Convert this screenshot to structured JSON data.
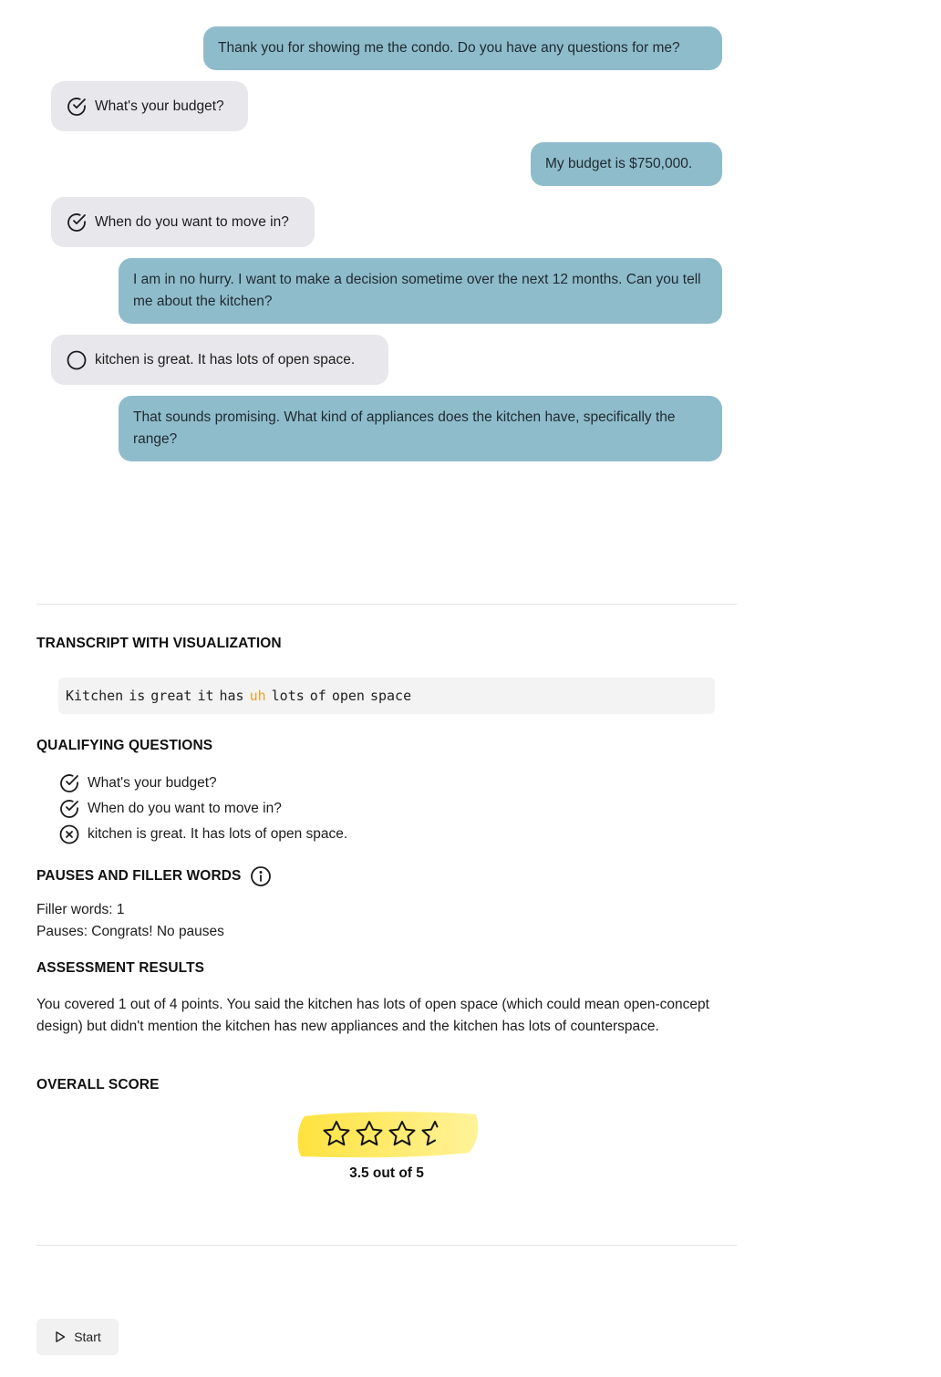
{
  "chat": {
    "messages": [
      {
        "role": "user",
        "text": "Thank you for showing me the condo. Do you have any questions for me?"
      },
      {
        "role": "bot",
        "status": "check",
        "status_icon": "check-circle-icon",
        "text": "What's your budget?"
      },
      {
        "role": "user",
        "text": "My budget is $750,000."
      },
      {
        "role": "bot",
        "status": "check",
        "status_icon": "check-circle-icon",
        "text": "When do you want to move in?"
      },
      {
        "role": "user",
        "text": "I am in no hurry. I want to make a decision sometime over the next 12 months. Can you tell me about the kitchen?"
      },
      {
        "role": "bot",
        "status": "empty",
        "status_icon": "empty-circle-icon",
        "text": "kitchen is great. It has lots of open space."
      },
      {
        "role": "user",
        "text": "That sounds promising. What kind of appliances does the kitchen have, specifically the range?"
      }
    ]
  },
  "transcript": {
    "title": "TRANSCRIPT WITH VISUALIZATION",
    "words": [
      "Kitchen",
      "is",
      "great",
      "it",
      "has",
      "uh",
      "lots",
      "of",
      "open",
      "space"
    ],
    "filler_word": "uh",
    "filler_color": "#f0a323"
  },
  "qualifying": {
    "title": "QUALIFYING QUESTIONS",
    "items": [
      {
        "text": "What's your budget?",
        "status": "check",
        "icon": "check-circle-icon"
      },
      {
        "text": "When do you want to move in?",
        "status": "check",
        "icon": "check-circle-icon"
      },
      {
        "text": "kitchen is great. It has lots of open space.",
        "status": "x",
        "icon": "x-circle-icon"
      }
    ]
  },
  "pauses": {
    "title": "PAUSES AND FILLER WORDS",
    "info_icon": "info-icon",
    "filler_line": "Filler words: 1",
    "pauses_line": "Pauses: Congrats! No pauses"
  },
  "assessment": {
    "title": "ASSESSMENT RESULTS",
    "text": "You covered 1 out of 4 points. You said the kitchen has lots of open space (which could mean open-concept design) but didn't mention the kitchen has new appliances and the kitchen has lots of counterspace."
  },
  "overall": {
    "title": "OVERALL SCORE",
    "score": 3.5,
    "max": 5,
    "label": "3.5 out of 5",
    "highlight_color": "#ffe45a"
  },
  "controls": {
    "start_label": "Start",
    "start_icon": "play-icon"
  },
  "colors": {
    "user_bubble": "#8fbccb",
    "bot_bubble": "#e8e8ec"
  }
}
